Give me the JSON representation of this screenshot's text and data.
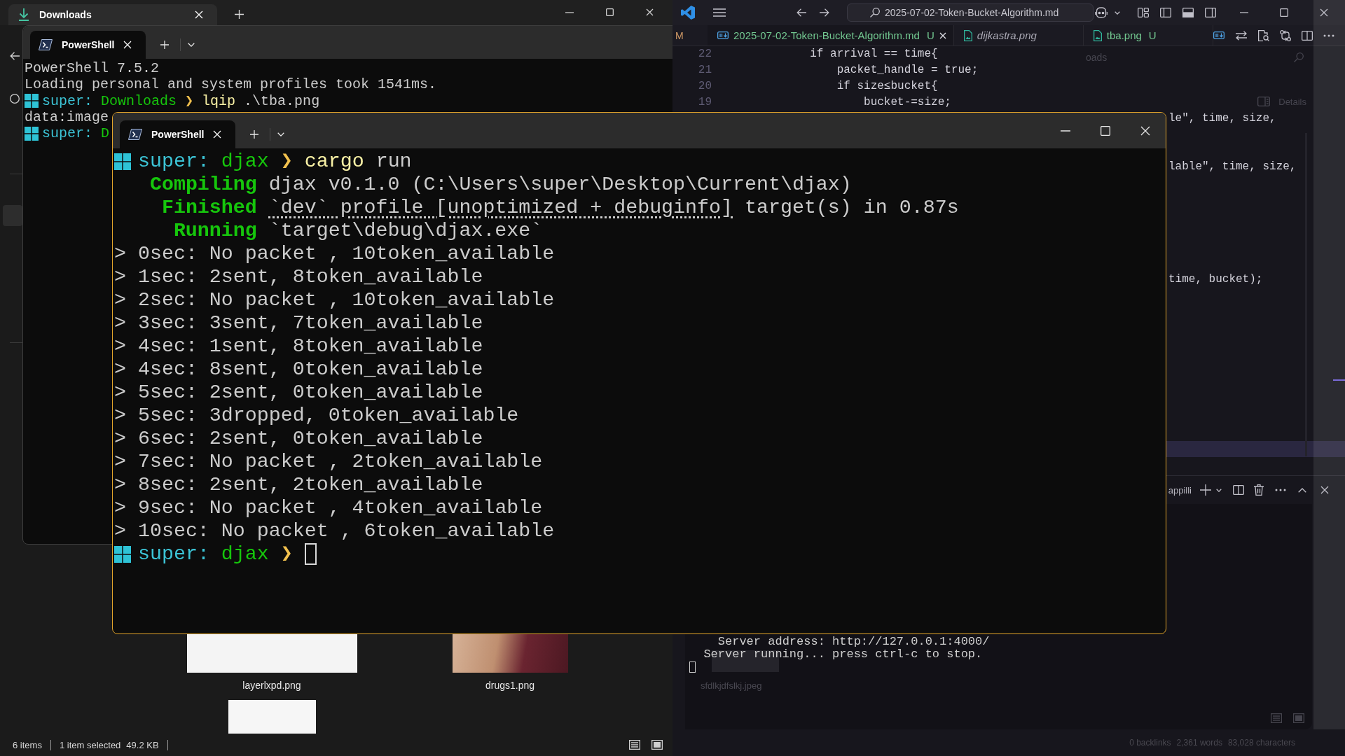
{
  "explorer": {
    "tab": {
      "title": "Downloads"
    },
    "files": [
      {
        "name": "layerlxpd.png",
        "kind": "drawing"
      },
      {
        "name": "drugs1.png",
        "kind": "photo"
      },
      {
        "kind": "diagram"
      }
    ],
    "status_bar": {
      "count": "6 items",
      "selection": "1 item selected",
      "size": "49.2 KB"
    }
  },
  "back_terminal": {
    "focused": false,
    "tab": {
      "title": "PowerShell",
      "selected": true
    },
    "lines": [
      {
        "kind": "output",
        "text": "PowerShell 7.5.2"
      },
      {
        "kind": "output",
        "text": "Loading personal and system profiles took 1541ms."
      },
      {
        "kind": "prompt",
        "user": "super:",
        "dir": "Downloads",
        "symbol": "❯",
        "command": "lqip",
        "args": ".\\tba.png"
      },
      {
        "kind": "output",
        "text": "data:image"
      },
      {
        "kind": "prompt",
        "user": "super:",
        "dir": "D"
      }
    ]
  },
  "editor": {
    "search": "2025-07-02-Token-Bucket-Algorithm.md",
    "tab_marker": "M",
    "tabs": [
      {
        "label": "2025-07-02-Token-Bucket-Algorithm.md",
        "kind": "markdown",
        "git": "U",
        "selected": true,
        "preview": false
      },
      {
        "label": "dijkastra.png",
        "kind": "image",
        "selected": false,
        "preview": true
      },
      {
        "label": "tba.png",
        "kind": "image",
        "git": "U",
        "selected": false,
        "preview": false
      }
    ],
    "lines": [
      {
        "number": "22",
        "code": "            if arrival == time{"
      },
      {
        "number": "21",
        "code": "                packet_handle = true;"
      },
      {
        "number": "20",
        "code": "                if size≤bucket{"
      },
      {
        "number": "19",
        "code": "                    bucket-=size;"
      }
    ],
    "fragments": [
      "le\", time, size,",
      "lable\", time, size,",
      "time, bucket);"
    ],
    "panel": {
      "title": "appilli",
      "lines": [
        "    Server address: http://127.0.0.1:4000/",
        "  Server running... press ctrl-c to stop."
      ],
      "cursor": true
    }
  },
  "overlay": {
    "title": "oads",
    "details": "Details",
    "file": "sfdlkjdfslkj.jpeg",
    "status": [
      "0 backlinks",
      "2,361 words",
      "83,028 characters"
    ]
  },
  "front_terminal": {
    "focused": true,
    "tab": {
      "title": "PowerShell",
      "selected": true
    },
    "lines": [
      {
        "kind": "prompt",
        "user": "super:",
        "dir": "djax",
        "symbol": "❯",
        "command": "cargo",
        "args": "run"
      },
      {
        "kind": "status",
        "status": "Compiling",
        "text": "djax v0.1.0 (C:\\Users\\super\\Desktop\\Current\\djax)"
      },
      {
        "kind": "status",
        "status": "Finished",
        "link": "`dev` profile [unoptimized + debuginfo]",
        "text": "target(s) in 0.87s"
      },
      {
        "kind": "status",
        "status": "Running",
        "text": "`target\\debug\\djax.exe`"
      },
      {
        "kind": "output",
        "text": "> 0sec: No packet , 10token_available"
      },
      {
        "kind": "output",
        "text": "> 1sec: 2sent, 8token_available"
      },
      {
        "kind": "output",
        "text": "> 2sec: No packet , 10token_available"
      },
      {
        "kind": "output",
        "text": "> 3sec: 3sent, 7token_available"
      },
      {
        "kind": "output",
        "text": "> 4sec: 1sent, 8token_available"
      },
      {
        "kind": "output",
        "text": "> 4sec: 8sent, 0token_available"
      },
      {
        "kind": "output",
        "text": "> 5sec: 2sent, 0token_available"
      },
      {
        "kind": "output",
        "text": "> 5sec: 3dropped, 0token_available"
      },
      {
        "kind": "output",
        "text": "> 6sec: 2sent, 0token_available"
      },
      {
        "kind": "output",
        "text": "> 7sec: No packet , 2token_available"
      },
      {
        "kind": "output",
        "text": "> 8sec: 2sent, 2token_available"
      },
      {
        "kind": "output",
        "text": "> 9sec: No packet , 4token_available"
      },
      {
        "kind": "output",
        "text": "> 10sec: No packet , 6token_available"
      },
      {
        "kind": "prompt",
        "user": "super:",
        "dir": "djax",
        "symbol": "❯",
        "cursor": true
      }
    ]
  }
}
